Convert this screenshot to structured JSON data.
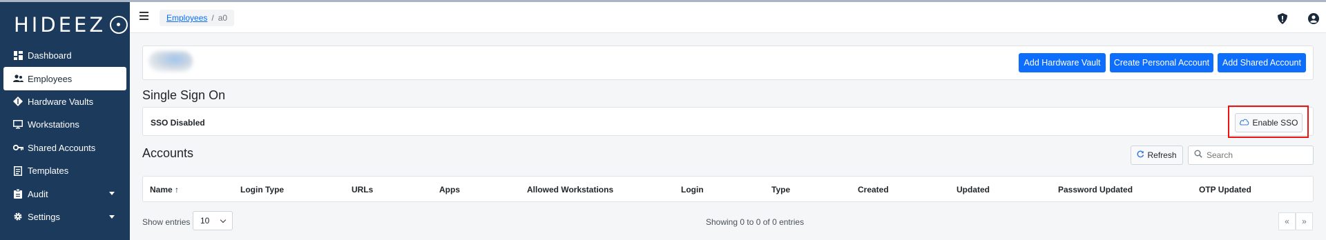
{
  "brand": {
    "logo_text": "HIDEEZ"
  },
  "sidebar": {
    "items": [
      {
        "label": "Dashboard",
        "icon": "dashboard-icon"
      },
      {
        "label": "Employees",
        "icon": "users-icon",
        "active": true
      },
      {
        "label": "Hardware Vaults",
        "icon": "vault-icon"
      },
      {
        "label": "Workstations",
        "icon": "monitor-icon"
      },
      {
        "label": "Shared Accounts",
        "icon": "key-icon"
      },
      {
        "label": "Templates",
        "icon": "template-icon"
      },
      {
        "label": "Audit",
        "icon": "clipboard-icon",
        "expandable": true
      },
      {
        "label": "Settings",
        "icon": "gear-icon",
        "expandable": true
      }
    ]
  },
  "header": {
    "breadcrumb": {
      "parent": "Employees",
      "separator": "/",
      "current": "a0"
    }
  },
  "actions": {
    "add_hardware_vault": "Add Hardware Vault",
    "create_personal_account": "Create Personal Account",
    "add_shared_account": "Add Shared Account"
  },
  "sso": {
    "title": "Single Sign On",
    "status": "SSO Disabled",
    "enable_label": "Enable SSO"
  },
  "accounts": {
    "title": "Accounts",
    "refresh_label": "Refresh",
    "search_placeholder": "Search",
    "columns": [
      "Name",
      "Login Type",
      "URLs",
      "Apps",
      "Allowed Workstations",
      "Login",
      "Type",
      "Created",
      "Updated",
      "Password Updated",
      "OTP Updated"
    ],
    "sort_indicator": "↑",
    "show_entries_label": "Show entries",
    "page_size": "10",
    "summary": "Showing 0 to 0 of 0 entries",
    "prev": "«",
    "next": "»"
  },
  "colors": {
    "sidebar": "#1b3a5c",
    "primary": "#0d6efd",
    "highlight": "#e11111"
  }
}
